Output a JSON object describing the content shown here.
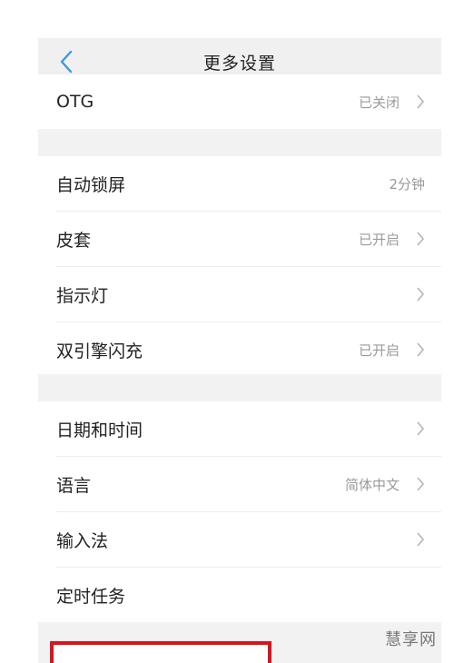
{
  "header": {
    "title": "更多设置",
    "back_icon": "chevron-left-icon"
  },
  "colors": {
    "accent": "#3a9bd9",
    "highlight_box": "#d9141c"
  },
  "sections": [
    {
      "items": [
        {
          "label": "OTG",
          "value": "已关闭",
          "arrow": true
        }
      ]
    },
    {
      "items": [
        {
          "label": "自动锁屏",
          "value": "2分钟",
          "arrow": false
        },
        {
          "label": "皮套",
          "value": "已开启",
          "arrow": true
        },
        {
          "label": "指示灯",
          "value": "",
          "arrow": true
        },
        {
          "label": "双引擎闪充",
          "value": "已开启",
          "arrow": true
        }
      ]
    },
    {
      "items": [
        {
          "label": "日期和时间",
          "value": "",
          "arrow": true
        },
        {
          "label": "语言",
          "value": "简体中文",
          "arrow": true
        },
        {
          "label": "输入法",
          "value": "",
          "arrow": true
        },
        {
          "label": "定时任务",
          "value": "",
          "arrow": false
        }
      ]
    }
  ],
  "watermark": "慧享网"
}
